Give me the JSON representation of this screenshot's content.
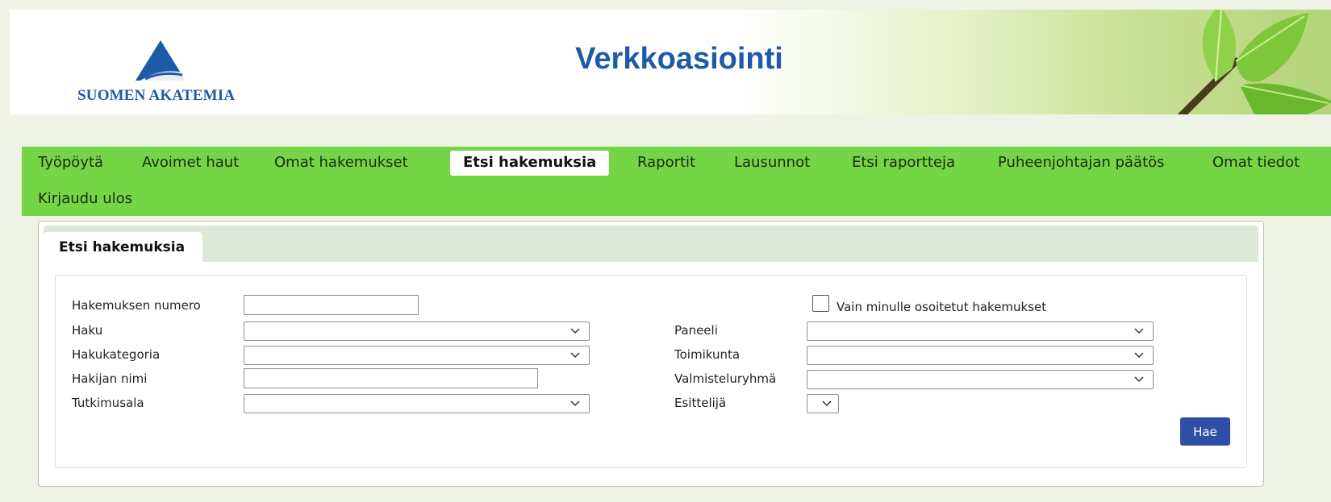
{
  "header": {
    "logo_text": "SUOMEN AKATEMIA",
    "title": "Verkkoasiointi"
  },
  "nav": {
    "items": [
      {
        "label": "Työpöytä",
        "active": false
      },
      {
        "label": "Avoimet haut",
        "active": false
      },
      {
        "label": "Omat hakemukset",
        "active": false
      },
      {
        "label": "Etsi hakemuksia",
        "active": true
      },
      {
        "label": "Raportit",
        "active": false
      },
      {
        "label": "Lausunnot",
        "active": false
      },
      {
        "label": "Etsi raportteja",
        "active": false
      },
      {
        "label": "Puheenjohtajan päätös",
        "active": false
      },
      {
        "label": "Omat tiedot",
        "active": false
      },
      {
        "label": "Kirjaudu ulos",
        "active": false
      }
    ]
  },
  "panel": {
    "tab_label": "Etsi hakemuksia"
  },
  "form": {
    "left": {
      "number_label": "Hakemuksen numero",
      "number_value": "",
      "haku_label": "Haku",
      "haku_value": "",
      "category_label": "Hakukategoria",
      "category_value": "",
      "applicant_label": "Hakijan nimi",
      "applicant_value": "",
      "field_label": "Tutkimusala",
      "field_value": ""
    },
    "right": {
      "only_mine_label": "Vain minulle osoitetut hakemukset",
      "only_mine_checked": false,
      "panel_label": "Paneeli",
      "panel_value": "",
      "committee_label": "Toimikunta",
      "committee_value": "",
      "prep_group_label": "Valmisteluryhmä",
      "prep_group_value": "",
      "presenter_label": "Esittelijä",
      "presenter_value": ""
    },
    "search_button": "Hae"
  },
  "colors": {
    "brand_blue": "#1d5aa8",
    "nav_green": "#74d647",
    "button_blue": "#2f4fa6"
  }
}
